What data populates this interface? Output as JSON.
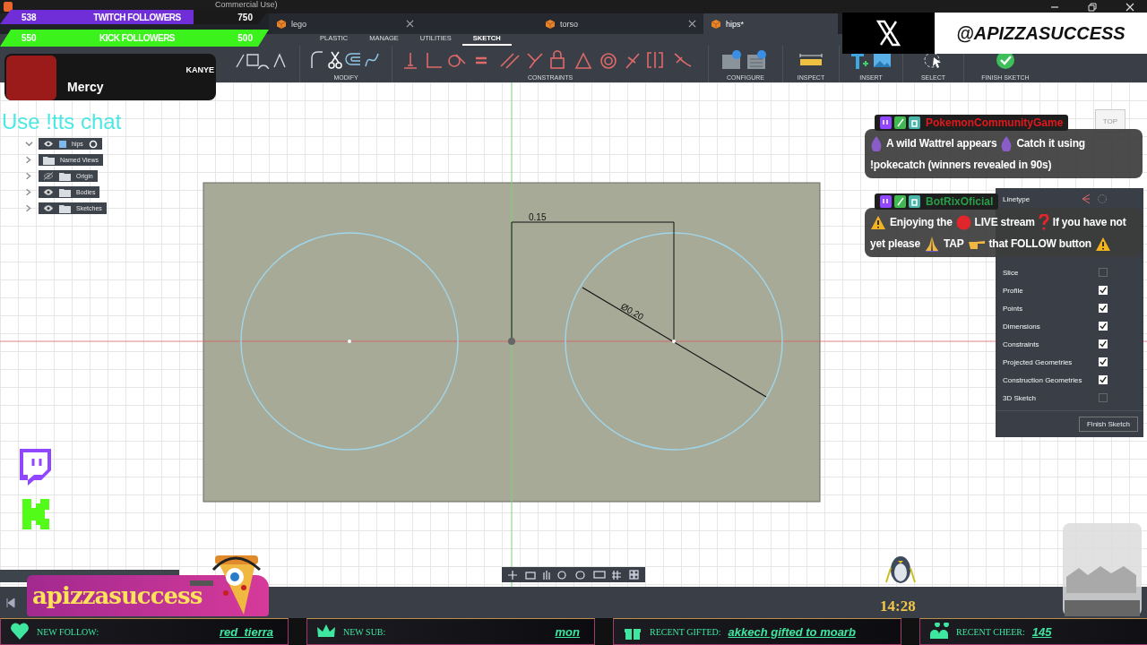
{
  "window": {
    "title_fragment": "Commercial Use)"
  },
  "document_tabs": [
    {
      "label": "lego",
      "selected": false
    },
    {
      "label": "torso",
      "selected": false
    },
    {
      "label": "hips*",
      "selected": true
    }
  ],
  "ribbon_tabs": [
    {
      "label": "PLASTIC",
      "selected": false
    },
    {
      "label": "MANAGE",
      "selected": false
    },
    {
      "label": "UTILITIES",
      "selected": false
    },
    {
      "label": "SKETCH",
      "selected": true
    }
  ],
  "ribbon_groups": [
    {
      "kind": "modify",
      "label": "MODIFY"
    },
    {
      "kind": "constraints",
      "label": "CONSTRAINTS"
    },
    {
      "kind": "configure",
      "label": "CONFIGURE"
    },
    {
      "kind": "inspect",
      "label": "INSPECT"
    },
    {
      "kind": "insert",
      "label": "INSERT"
    },
    {
      "kind": "select",
      "label": "SELECT"
    },
    {
      "kind": "finish",
      "label": "FINISH SKETCH"
    }
  ],
  "browser": {
    "label": "hips",
    "expanded": true,
    "children": [
      {
        "label": "Named Views",
        "kind": "folder"
      },
      {
        "label": "Origin",
        "kind": "folder-eye",
        "visible": false
      },
      {
        "label": "Bodies",
        "kind": "folder-eye",
        "visible": true
      },
      {
        "label": "Sketches",
        "kind": "folder-eye",
        "visible": true
      }
    ]
  },
  "sketch": {
    "dimension": "0.15",
    "diameter": "Ø0.20"
  },
  "view_cube": {
    "label": "TOP"
  },
  "sketch_palette": {
    "linetype": "Linetype",
    "options": [
      {
        "label": "Slice",
        "checked": false
      },
      {
        "label": "Profile",
        "checked": true
      },
      {
        "label": "Points",
        "checked": true
      },
      {
        "label": "Dimensions",
        "checked": true
      },
      {
        "label": "Constraints",
        "checked": true
      },
      {
        "label": "Projected Geometries",
        "checked": true
      },
      {
        "label": "Construction Geometries",
        "checked": true
      },
      {
        "label": "3D Sketch",
        "checked": false
      }
    ],
    "button": "Finish Sketch"
  },
  "follower_goals": [
    {
      "kind": "twitch",
      "count": "538",
      "label": "TWITCH FOLLOWERS",
      "goal": "750"
    },
    {
      "kind": "kick",
      "count": "550",
      "label": "KICK FOLLOWERS",
      "goal": "500"
    }
  ],
  "now_playing": {
    "title": "Mercy",
    "artist": "KANYE"
  },
  "tts_hint": "Use !tts chat",
  "x_handle": "@APIZZASUCCESS",
  "chat": [
    {
      "user": "PokemonCommunityGame",
      "color": "#e0191c",
      "segments": [
        {
          "kind": "droplet"
        },
        {
          "kind": "text",
          "text": "A wild Wattrel appears"
        },
        {
          "kind": "droplet"
        },
        {
          "kind": "text",
          "text": "Catch it using"
        },
        {
          "kind": "text",
          "text": "!pokecatch (winners revealed in 90s)"
        }
      ]
    },
    {
      "user": "BotRixOficial",
      "color": "#2a9d48",
      "segments": [
        {
          "kind": "warning"
        },
        {
          "kind": "text",
          "text": "Enjoying the"
        },
        {
          "kind": "red-dot"
        },
        {
          "kind": "text",
          "text": "LIVE stream"
        },
        {
          "kind": "question"
        },
        {
          "kind": "text",
          "text": "If you have not"
        },
        {
          "kind": "text",
          "text": "yet please"
        },
        {
          "kind": "pray"
        },
        {
          "kind": "text",
          "text": "TAP"
        },
        {
          "kind": "point"
        },
        {
          "kind": "text",
          "text": "that FOLLOW button"
        },
        {
          "kind": "warning"
        }
      ]
    }
  ],
  "streamer_banner": "apizzasuccess",
  "clock": "14:28",
  "alerts": [
    {
      "kind": "follow",
      "label": "NEW FOLLOW:",
      "value": "red_tierra"
    },
    {
      "kind": "sub",
      "label": "NEW SUB:",
      "value": "mon"
    },
    {
      "kind": "gift",
      "label": "RECENT GIFTED:",
      "value": "akkech gifted to moarb"
    },
    {
      "kind": "cheer",
      "label": "RECENT CHEER:",
      "value": "145"
    }
  ]
}
